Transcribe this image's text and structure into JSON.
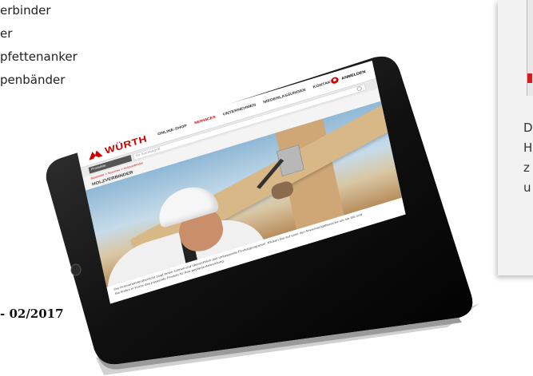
{
  "left_text": {
    "items": [
      "erbinder",
      "er",
      "pfettenanker",
      "penbänder"
    ],
    "issue": "- 02/2017"
  },
  "right_card": {
    "lines": [
      "D",
      "H",
      "z",
      "u"
    ]
  },
  "website": {
    "logo_text": "WÜRTH",
    "nav": [
      "ONLINE-SHOP",
      "SERVICES",
      "UNTERNEHMEN",
      "NIEDERLASSUNGEN",
      "KONTAKT"
    ],
    "active_nav": "SERVICES",
    "login_label": "ANMELDEN",
    "search_category": "Produkte",
    "search_placeholder": "Ihr Suchbegriff",
    "breadcrumb": "Startseite > Services > Holzverbinder",
    "page_title": "HOLZVERBINDER",
    "caption_line1": "Die Holzverbinderübersicht zeigt Ihnen schnell und übersichtlich das umfassende Produktprogramm. Klicken Sie auf einer der Anwendungsbereiche um sie Sie und",
    "caption_line2": "Sie finden in Kürze das passende Produkt für Ihre geplante Anwendung."
  },
  "colors": {
    "brand_red": "#cc0000",
    "tablet_black": "#0c0c0c"
  }
}
